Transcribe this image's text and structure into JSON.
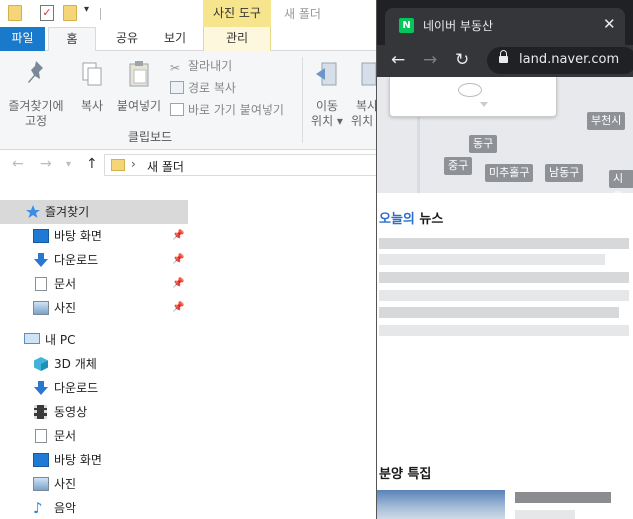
{
  "explorer": {
    "window_title": "새 폴더",
    "context_tool_label": "사진 도구",
    "tabs": {
      "file": "파일",
      "home": "홈",
      "share": "공유",
      "view": "보기",
      "manage": "관리"
    },
    "ribbon": {
      "pin_quick_access": "즐겨찾기에\n고정",
      "copy": "복사",
      "paste": "붙여넣기",
      "cut": "잘라내기",
      "copy_path": "경로 복사",
      "paste_shortcut": "바로 가기 붙여넣기",
      "move_to": "이동\n위치 ▾",
      "copy_to": "복사\n위치 ▾",
      "group_clipboard": "클립보드"
    },
    "address": {
      "current": "새 폴더"
    },
    "nav": {
      "quick_access": "즐겨찾기",
      "qa_items": [
        "바탕 화면",
        "다운로드",
        "문서",
        "사진"
      ],
      "this_pc": "내 PC",
      "pc_items": [
        "3D 개체",
        "다운로드",
        "동영상",
        "문서",
        "바탕 화면",
        "사진",
        "음악"
      ]
    },
    "colors": {
      "file_tab": "#1979ca",
      "context_tab": "#f6e58c",
      "selected_nav": "#d9d9d9"
    }
  },
  "browser": {
    "tab_title": "네이버 부동산",
    "favicon_letter": "N",
    "url": "land.naver.com",
    "map_labels": [
      "부천시",
      "동구",
      "중구",
      "미추홀구",
      "남동구",
      "시흥"
    ],
    "news_heading_accent": "오늘의",
    "news_heading_rest": " 뉴스",
    "special_heading": "분양 특집",
    "colors": {
      "chrome_dark": "#202124",
      "chrome_tab": "#35363a",
      "naver_green": "#03c75a",
      "accent_blue": "#2d6fd0"
    }
  }
}
